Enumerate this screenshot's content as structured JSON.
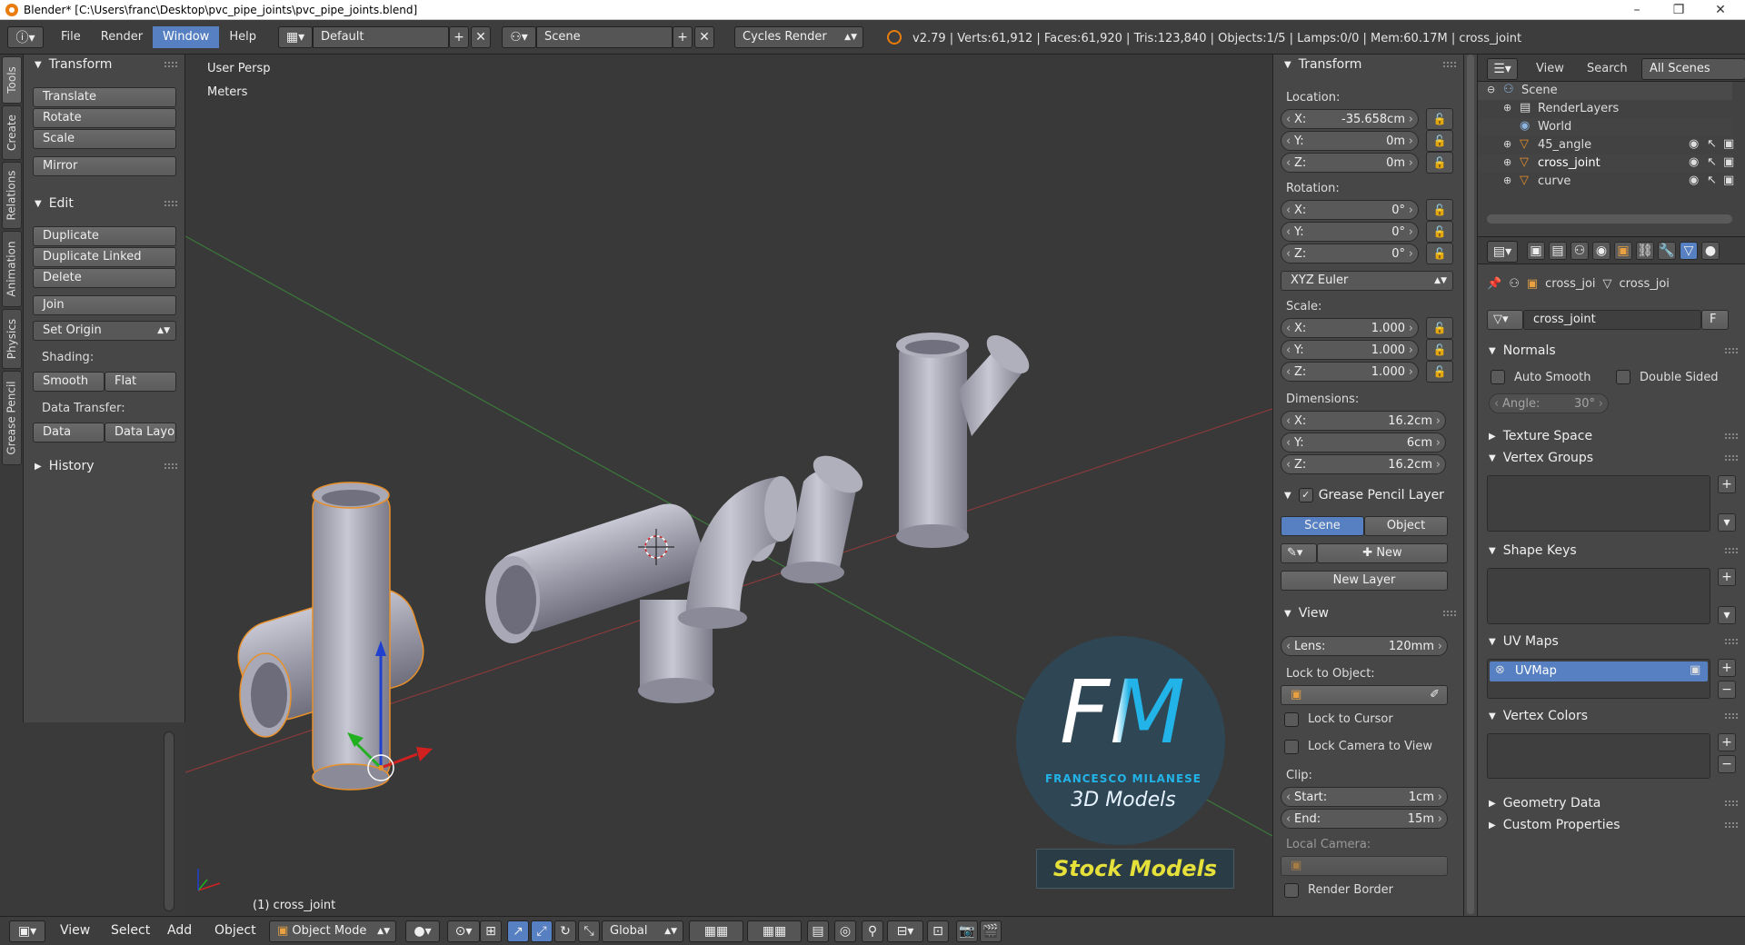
{
  "window": {
    "title": "Blender* [C:\\Users\\franc\\Desktop\\pvc_pipe_joints\\pvc_pipe_joints.blend]",
    "minimize": "–",
    "maximize": "❐",
    "close": "✕"
  },
  "menubar": {
    "file": "File",
    "render": "Render",
    "window": "Window",
    "help": "Help",
    "layout": "Default",
    "scene": "Scene",
    "engine": "Cycles Render"
  },
  "stats": "v2.79 | Verts:61,912 | Faces:61,920 | Tris:123,840 | Objects:1/5 | Lamps:0/0 | Mem:60.17M | cross_joint",
  "tabs": [
    "Tools",
    "Create",
    "Relations",
    "Animation",
    "Physics",
    "Grease Pencil"
  ],
  "tools": {
    "transform_header": "Transform",
    "translate": "Translate",
    "rotate": "Rotate",
    "scale": "Scale",
    "mirror": "Mirror",
    "edit_header": "Edit",
    "duplicate": "Duplicate",
    "duplicate_linked": "Duplicate Linked",
    "delete": "Delete",
    "join": "Join",
    "set_origin": "Set Origin",
    "shading_label": "Shading:",
    "smooth": "Smooth",
    "flat": "Flat",
    "data_transfer_label": "Data Transfer:",
    "data": "Data",
    "data_layo": "Data Layo",
    "history_header": "History"
  },
  "viewport": {
    "view_name": "User Persp",
    "units": "Meters",
    "object_label": "(1) cross_joint"
  },
  "watermark": {
    "letters": "FM",
    "name": "FRANCESCO MILANESE",
    "sub": "3D Models",
    "stock": "Stock Models"
  },
  "npanel": {
    "transform_header": "Transform",
    "location_label": "Location:",
    "loc_x": "-35.658cm",
    "loc_y": "0m",
    "loc_z": "0m",
    "rotation_label": "Rotation:",
    "rot_x": "0°",
    "rot_y": "0°",
    "rot_z": "0°",
    "euler": "XYZ Euler",
    "scale_label": "Scale:",
    "sc_x": "1.000",
    "sc_y": "1.000",
    "sc_z": "1.000",
    "dimensions_label": "Dimensions:",
    "dim_x": "16.2cm",
    "dim_y": "6cm",
    "dim_z": "16.2cm",
    "x": "X:",
    "y": "Y:",
    "z": "Z:",
    "gp_header": "Grease Pencil Layer",
    "gp_scene": "Scene",
    "gp_object": "Object",
    "gp_new": "New",
    "gp_new_layer": "New Layer",
    "view_header": "View",
    "lens_label": "Lens:",
    "lens": "120mm",
    "lock_obj_label": "Lock to Object:",
    "lock_cursor": "Lock to Cursor",
    "lock_camera": "Lock Camera to View",
    "clip_label": "Clip:",
    "start_label": "Start:",
    "start": "1cm",
    "end_label": "End:",
    "end": "15m",
    "local_camera": "Local Camera:",
    "render_border": "Render Border"
  },
  "outliner": {
    "view": "View",
    "search": "Search",
    "all_scenes": "All Scenes",
    "items": [
      "Scene",
      "RenderLayers",
      "World",
      "45_angle",
      "cross_joint",
      "curve"
    ]
  },
  "properties": {
    "breadcrumb_obj": "cross_joi",
    "breadcrumb_mesh": "cross_joi",
    "mesh_name": "cross_joint",
    "fake_user": "F",
    "normals": "Normals",
    "auto_smooth": "Auto Smooth",
    "double_sided": "Double Sided",
    "angle_label": "Angle:",
    "angle": "30°",
    "texture_space": "Texture Space",
    "vertex_groups": "Vertex Groups",
    "shape_keys": "Shape Keys",
    "uv_maps": "UV Maps",
    "uvmap": "UVMap",
    "vertex_colors": "Vertex Colors",
    "geometry_data": "Geometry Data",
    "custom_properties": "Custom Properties"
  },
  "bottombar": {
    "view": "View",
    "select": "Select",
    "add": "Add",
    "object": "Object",
    "mode": "Object Mode",
    "orientation": "Global"
  },
  "colors": {
    "accent": "#5680c2",
    "selected_outline": "#e8902a",
    "axis_x": "#b03030",
    "axis_y": "#3a9a3a"
  }
}
